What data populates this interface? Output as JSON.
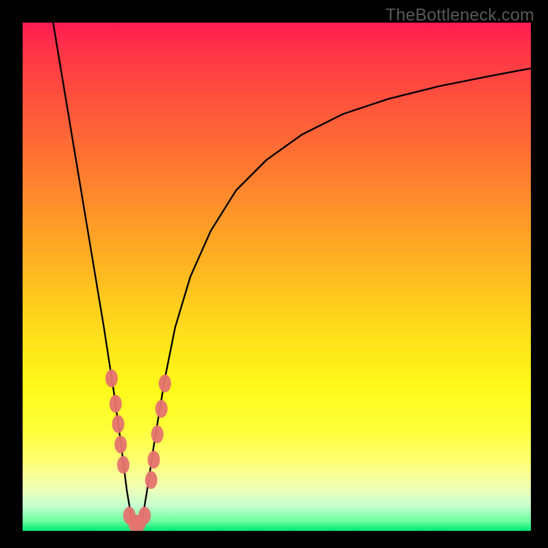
{
  "watermark": "TheBottleneck.com",
  "chart_data": {
    "type": "line",
    "title": "",
    "xlabel": "",
    "ylabel": "",
    "xlim": [
      0,
      100
    ],
    "ylim": [
      0,
      100
    ],
    "grid": false,
    "legend": false,
    "series": [
      {
        "name": "bottleneck-curve",
        "color": "#000000",
        "x": [
          6,
          8,
          10,
          12,
          14,
          16,
          18,
          19.5,
          20.5,
          21.5,
          22.5,
          23.5,
          24.5,
          26,
          28,
          30,
          33,
          37,
          42,
          48,
          55,
          63,
          72,
          82,
          92,
          100
        ],
        "y": [
          100,
          88,
          76,
          64,
          52,
          40,
          27,
          16,
          8,
          2,
          0,
          2,
          8,
          18,
          30,
          40,
          50,
          59,
          67,
          73,
          78,
          82,
          85,
          87.5,
          89.5,
          91
        ]
      }
    ],
    "markers": {
      "name": "sample-points",
      "color": "#e5736f",
      "points": [
        {
          "x": 17.5,
          "y": 30
        },
        {
          "x": 18.3,
          "y": 25
        },
        {
          "x": 18.8,
          "y": 21
        },
        {
          "x": 19.3,
          "y": 17
        },
        {
          "x": 19.8,
          "y": 13
        },
        {
          "x": 21.0,
          "y": 3
        },
        {
          "x": 22.0,
          "y": 1.5
        },
        {
          "x": 23.0,
          "y": 1.5
        },
        {
          "x": 24.0,
          "y": 3
        },
        {
          "x": 25.3,
          "y": 10
        },
        {
          "x": 25.8,
          "y": 14
        },
        {
          "x": 26.5,
          "y": 19
        },
        {
          "x": 27.3,
          "y": 24
        },
        {
          "x": 28.0,
          "y": 29
        }
      ]
    }
  }
}
